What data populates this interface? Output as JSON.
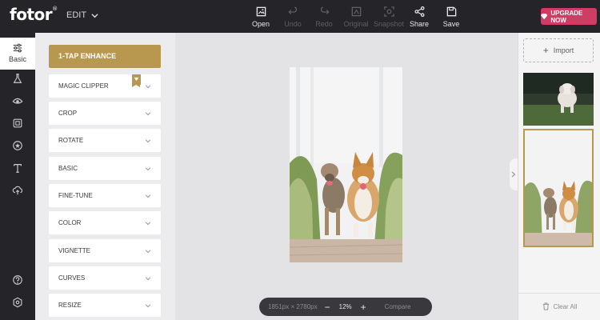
{
  "app": {
    "logo": "fotor",
    "logo_mark": "®",
    "mode_menu": "EDIT",
    "upgrade_label": "UPGRADE NOW"
  },
  "toolbar": [
    {
      "label": "Open",
      "icon": "open-icon",
      "enabled": true
    },
    {
      "label": "Undo",
      "icon": "undo-icon",
      "enabled": false
    },
    {
      "label": "Redo",
      "icon": "redo-icon",
      "enabled": false
    },
    {
      "label": "Original",
      "icon": "original-icon",
      "enabled": false
    },
    {
      "label": "Snapshot",
      "icon": "snapshot-icon",
      "enabled": false
    },
    {
      "label": "Share",
      "icon": "share-icon",
      "enabled": true
    },
    {
      "label": "Save",
      "icon": "save-icon",
      "enabled": true
    }
  ],
  "rail": {
    "active_label": "Basic",
    "icons": [
      "sliders-icon",
      "flask-icon",
      "eye-icon",
      "frame-icon",
      "sticker-icon",
      "text-icon",
      "cloud-upload-icon",
      "help-icon",
      "settings-icon"
    ]
  },
  "panel": {
    "enhance_label": "1-TAP ENHANCE",
    "items": [
      "MAGIC CLIPPER",
      "CROP",
      "ROTATE",
      "BASIC",
      "FINE-TUNE",
      "COLOR",
      "VIGNETTE",
      "CURVES",
      "RESIZE"
    ]
  },
  "canvas": {
    "dimensions": "1851px × 2780px",
    "zoom": "12%",
    "compare_label": "Compare"
  },
  "right_panel": {
    "import_label": "Import",
    "clear_label": "Clear All"
  },
  "colors": {
    "dark": "#242429",
    "accent_gold": "#b8984f",
    "upgrade_pink": "#d23b63"
  }
}
